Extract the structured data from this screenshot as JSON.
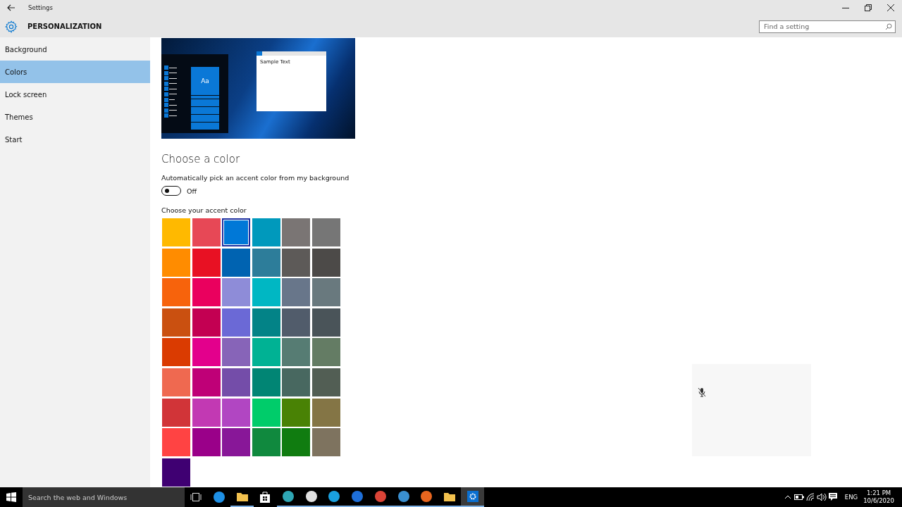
{
  "window": {
    "title": "Settings"
  },
  "header": {
    "title": "PERSONALIZATION"
  },
  "search": {
    "placeholder": "Find a setting"
  },
  "sidebar": {
    "items": [
      {
        "label": "Background",
        "selected": false
      },
      {
        "label": "Colors",
        "selected": true
      },
      {
        "label": "Lock screen",
        "selected": false
      },
      {
        "label": "Themes",
        "selected": false
      },
      {
        "label": "Start",
        "selected": false
      }
    ]
  },
  "preview": {
    "sample_text": "Sample Text",
    "tile_text": "Aa"
  },
  "section_title": "Choose a color",
  "auto_pick": {
    "label": "Automatically pick an accent color from my background",
    "on": false,
    "state_text": "Off"
  },
  "accent": {
    "label": "Choose your accent color",
    "swatches": [
      {
        "color": "#ffb900",
        "selected": false
      },
      {
        "color": "#e74856",
        "selected": false
      },
      {
        "color": "#0078d7",
        "selected": true
      },
      {
        "color": "#0099bc",
        "selected": false
      },
      {
        "color": "#7a7574",
        "selected": false
      },
      {
        "color": "#767676",
        "selected": false
      },
      {
        "color": "#ff8c00",
        "selected": false
      },
      {
        "color": "#e81123",
        "selected": false
      },
      {
        "color": "#0063b1",
        "selected": false
      },
      {
        "color": "#2d7d9a",
        "selected": false
      },
      {
        "color": "#5d5a58",
        "selected": false
      },
      {
        "color": "#4c4a48",
        "selected": false
      },
      {
        "color": "#f7630c",
        "selected": false
      },
      {
        "color": "#ea005e",
        "selected": false
      },
      {
        "color": "#8e8cd8",
        "selected": false
      },
      {
        "color": "#00b7c3",
        "selected": false
      },
      {
        "color": "#68768a",
        "selected": false
      },
      {
        "color": "#69797e",
        "selected": false
      },
      {
        "color": "#ca5010",
        "selected": false
      },
      {
        "color": "#c30052",
        "selected": false
      },
      {
        "color": "#6b69d6",
        "selected": false
      },
      {
        "color": "#038387",
        "selected": false
      },
      {
        "color": "#515c6b",
        "selected": false
      },
      {
        "color": "#4a5459",
        "selected": false
      },
      {
        "color": "#da3b01",
        "selected": false
      },
      {
        "color": "#e3008c",
        "selected": false
      },
      {
        "color": "#8764b8",
        "selected": false
      },
      {
        "color": "#00b294",
        "selected": false
      },
      {
        "color": "#567c73",
        "selected": false
      },
      {
        "color": "#647c64",
        "selected": false
      },
      {
        "color": "#ef6950",
        "selected": false
      },
      {
        "color": "#bf0077",
        "selected": false
      },
      {
        "color": "#744da9",
        "selected": false
      },
      {
        "color": "#018574",
        "selected": false
      },
      {
        "color": "#486860",
        "selected": false
      },
      {
        "color": "#525e54",
        "selected": false
      },
      {
        "color": "#d13438",
        "selected": false
      },
      {
        "color": "#c239b3",
        "selected": false
      },
      {
        "color": "#b146c2",
        "selected": false
      },
      {
        "color": "#00cc6a",
        "selected": false
      },
      {
        "color": "#498205",
        "selected": false
      },
      {
        "color": "#847545",
        "selected": false
      },
      {
        "color": "#ff4343",
        "selected": false
      },
      {
        "color": "#9a0089",
        "selected": false
      },
      {
        "color": "#881798",
        "selected": false
      },
      {
        "color": "#10893e",
        "selected": false
      },
      {
        "color": "#107c10",
        "selected": false
      },
      {
        "color": "#7e735f",
        "selected": false
      },
      {
        "color": "#3f0072",
        "selected": false
      }
    ]
  },
  "taskbar": {
    "search_placeholder": "Search the web and Windows",
    "apps": [
      {
        "kind": "taskview",
        "running": false,
        "selected": false
      },
      {
        "kind": "browser",
        "running": false,
        "selected": false
      },
      {
        "kind": "folder",
        "running": true,
        "selected": false
      },
      {
        "kind": "store",
        "running": false,
        "selected": false
      },
      {
        "kind": "browser2",
        "running": true,
        "selected": false
      },
      {
        "kind": "chat",
        "running": true,
        "selected": false
      },
      {
        "kind": "call",
        "running": true,
        "selected": false
      },
      {
        "kind": "remote",
        "running": true,
        "selected": false
      },
      {
        "kind": "chrome",
        "running": true,
        "selected": false
      },
      {
        "kind": "mail",
        "running": true,
        "selected": false
      },
      {
        "kind": "orange",
        "running": true,
        "selected": false
      },
      {
        "kind": "envelope",
        "running": true,
        "selected": false
      },
      {
        "kind": "settings",
        "running": true,
        "selected": true
      }
    ],
    "language": "ENG",
    "time": "1:21 PM",
    "date": "10/6/2020"
  }
}
